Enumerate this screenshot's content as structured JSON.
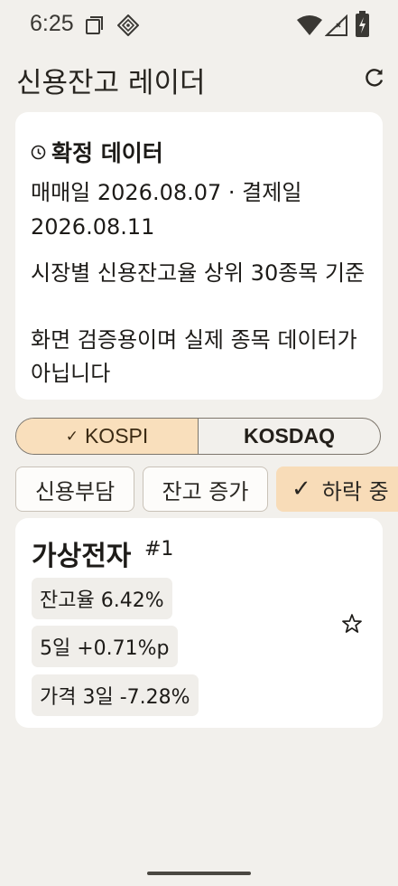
{
  "status_bar": {
    "time": "6:25",
    "icons": [
      "screen-icon",
      "app-notification-icon",
      "wifi-icon",
      "signal-icon",
      "battery-charging-icon"
    ]
  },
  "app_bar": {
    "title": "신용잔고 레이더",
    "action_icon": "refresh-icon"
  },
  "info_card": {
    "icon": "clock-icon",
    "title": "확정 데이터",
    "dates": "매매일 2026.08.07 · 결제일 2026.08.11",
    "note_basis": "시장별 신용잔고율 상위 30종목 기준",
    "note_disclaimer": "화면 검증용이며 실제 종목 데이터가 아닙니다"
  },
  "market_toggle": {
    "options": [
      {
        "label": "KOSPI",
        "selected": true
      },
      {
        "label": "KOSDAQ",
        "selected": false
      }
    ]
  },
  "filters": {
    "chips": [
      {
        "label": "신용부담",
        "selected": false
      },
      {
        "label": "잔고 증가",
        "selected": false
      },
      {
        "label": "하락 중",
        "selected": true
      }
    ]
  },
  "stocks": [
    {
      "name": "가상전자",
      "rank": "#1",
      "balance_ratio": "잔고율 6.42%",
      "change_5d": "5일 +0.71%p",
      "price_3d": "가격 3일 -7.28%",
      "favorite_icon": "star-outline-icon"
    }
  ],
  "colors": {
    "background": "#f2f0ec",
    "card": "#ffffff",
    "selected_accent": "#f9dfbc",
    "tag_background": "#f0eeea"
  }
}
